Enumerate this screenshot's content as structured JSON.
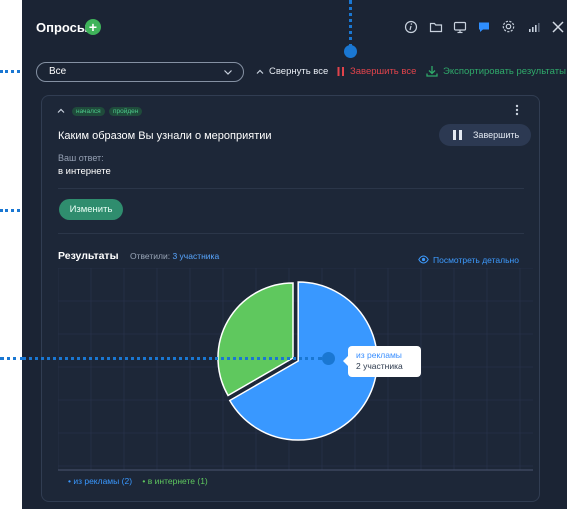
{
  "header": {
    "title": "Опросы",
    "add_icon": "plus-icon",
    "toolbar_icons": [
      "info-icon",
      "folder-icon",
      "screen-share-icon",
      "chat-icon",
      "settings-icon",
      "signal-icon",
      "close-icon"
    ]
  },
  "filter": {
    "selected": "Все"
  },
  "toolbar": {
    "collapse_all": "Свернуть все",
    "finish_all": "Завершить все",
    "export_results": "Экспортировать результаты"
  },
  "question": {
    "badges": [
      "начался",
      "пройден"
    ],
    "title": "Каким образом Вы узнали о мероприятии",
    "finish_button": "Завершить",
    "your_answer_label": "Ваш ответ:",
    "your_answer": "в интернете",
    "change_button": "Изменить"
  },
  "results": {
    "title": "Результаты",
    "answered_label": "Ответили:",
    "answered_count": "3 участника",
    "view_details": "Посмотреть детально",
    "tooltip": {
      "label": "из рекламы",
      "value": "2 участника"
    },
    "legend": [
      {
        "text": "из рекламы",
        "count": "(2)",
        "color": "#3998ff"
      },
      {
        "text": "в интернете",
        "count": "(1)",
        "color": "#5fc85e"
      }
    ]
  },
  "chart_data": {
    "type": "pie",
    "title": "",
    "categories": [
      "из рекламы",
      "в интернете"
    ],
    "values": [
      2,
      1
    ],
    "colors": [
      "#3998ff",
      "#5fc85e"
    ]
  },
  "colors": {
    "panel_bg": "#1b2434",
    "accent_green": "#3fb35a",
    "accent_red": "#e0434b",
    "accent_blue": "#3d9bff",
    "annotation_blue": "#1a77d2"
  }
}
